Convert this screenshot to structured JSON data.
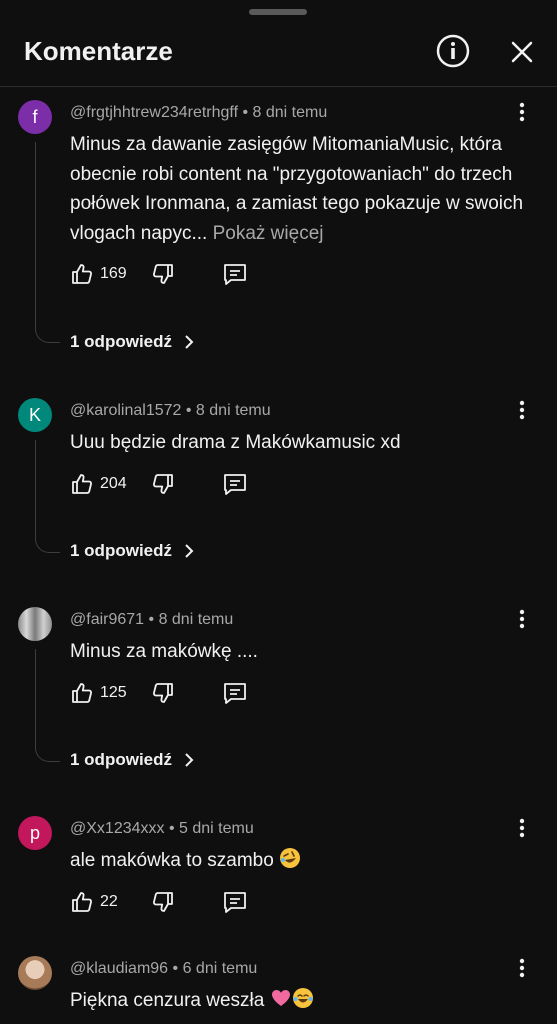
{
  "header": {
    "title": "Komentarze",
    "info_icon": "info-icon",
    "close_icon": "close-icon"
  },
  "colors": {
    "background": "#0f0f0f",
    "text": "#f1f1f1",
    "secondary": "#a8a8a8"
  },
  "comments": [
    {
      "avatar_letter": "f",
      "avatar_color": "#7b2ea8",
      "author": "@frgtjhhtrew234retrhgff",
      "time": "8 dni temu",
      "text": "Minus za dawanie zasięgów MitomaniaMusic, która obecnie robi content na \"przygotowaniach\" do trzech połówek Ironmana, a zamiast tego pokazuje w swoich vlogach napyc...",
      "more": "Pokaż więcej",
      "likes": "169",
      "replies": "1 odpowiedź"
    },
    {
      "avatar_letter": "K",
      "avatar_color": "#00897b",
      "author": "@karolinal1572",
      "time": "8 dni temu",
      "text": "Uuu będzie drama z Makówkamusic xd",
      "likes": "204",
      "replies": "1 odpowiedź"
    },
    {
      "avatar_letter": "",
      "avatar_color": "#9e9e9e",
      "author": "@fair9671",
      "time": "8 dni temu",
      "text": "Minus za makówkę ....",
      "likes": "125",
      "replies": "1 odpowiedź"
    },
    {
      "avatar_letter": "p",
      "avatar_color": "#c2185b",
      "author": "@Xx1234xxx",
      "time": "5 dni temu",
      "text": "ale makówka to szambo",
      "likes": "22"
    },
    {
      "avatar_letter": "",
      "avatar_color": "#c9a58c",
      "author": "@klaudiam96",
      "time": "6 dni temu",
      "text": "Piękna cenzura weszła"
    }
  ]
}
